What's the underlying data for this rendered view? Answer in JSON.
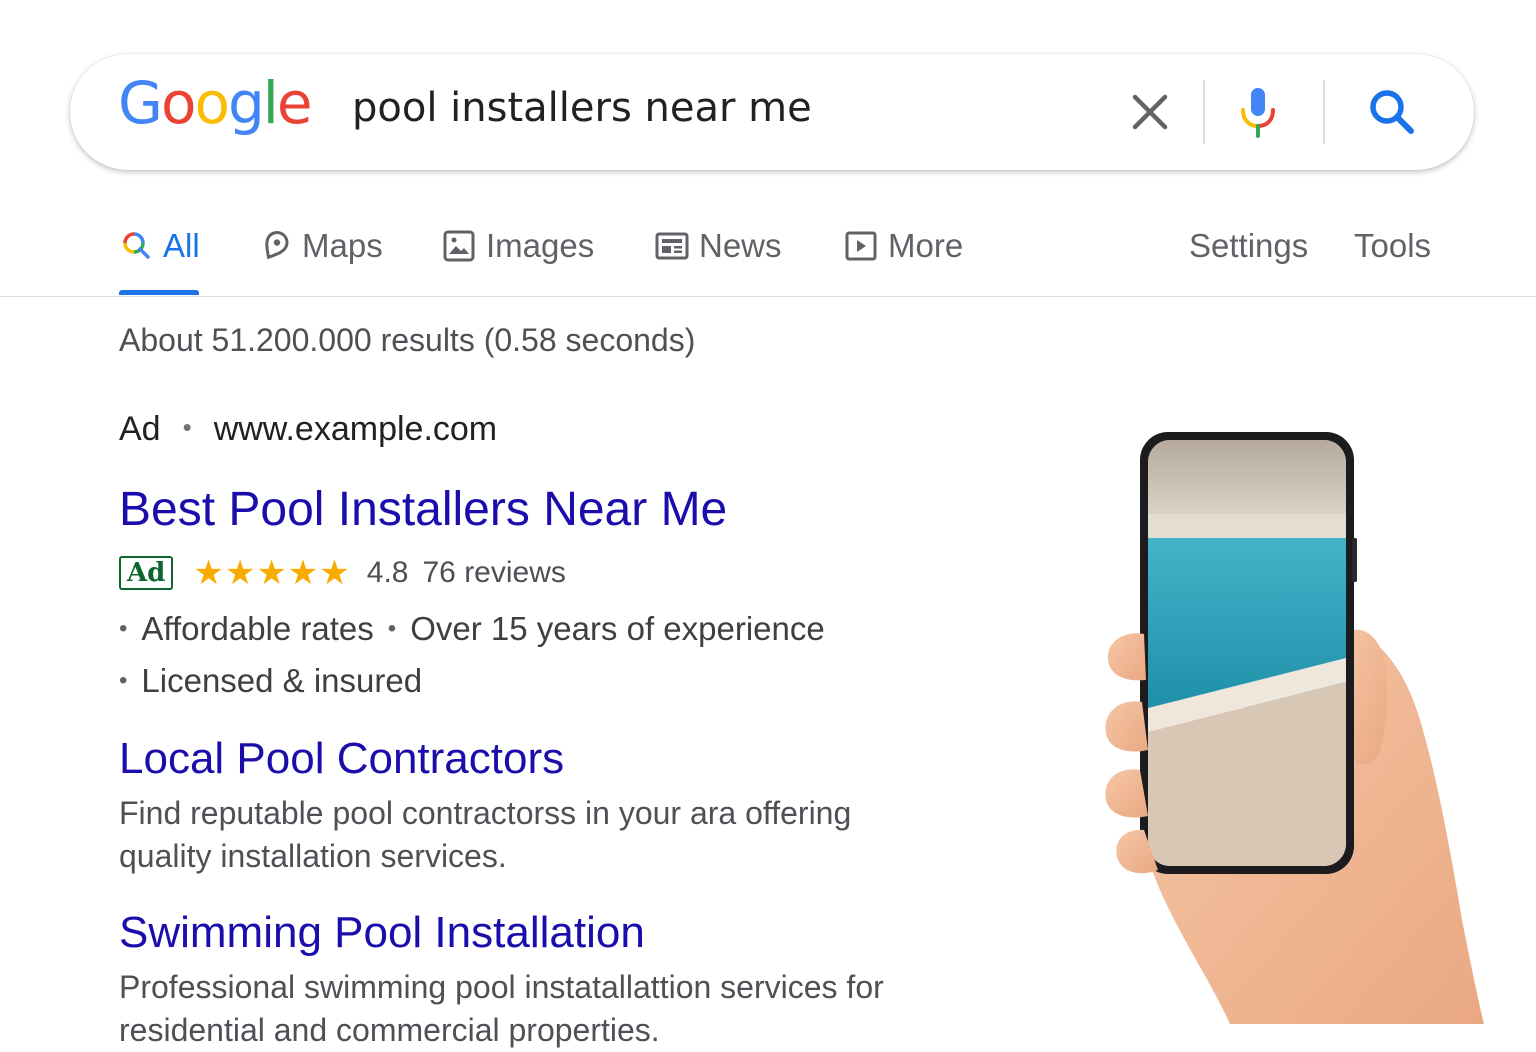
{
  "search": {
    "logo_letters": [
      {
        "ch": "G",
        "color": "#4285F4"
      },
      {
        "ch": "o",
        "color": "#EA4335"
      },
      {
        "ch": "o",
        "color": "#FBBC05"
      },
      {
        "ch": "g",
        "color": "#4285F4"
      },
      {
        "ch": "l",
        "color": "#34A853"
      },
      {
        "ch": "e",
        "color": "#EA4335"
      }
    ],
    "query": "pool installers near me",
    "icons": [
      "close-icon",
      "microphone-icon",
      "search-icon"
    ]
  },
  "tabs": {
    "all": "All",
    "maps": "Maps",
    "images": "Images",
    "news": "News",
    "more": "More",
    "settings": "Settings",
    "tools": "Tools",
    "active": "all"
  },
  "results": {
    "stats": "About 51.200.000 results (0.58 seconds)",
    "ad_label": "Ad",
    "ad_url": "www.example.com",
    "main_title": "Best Pool Installers Near Me",
    "ad_badge": "Ad",
    "stars": "★★★★★",
    "rating": "4.8",
    "reviews": "76 reviews",
    "bullets": [
      "Affordable rates",
      "Over 15 years of experience",
      "Licensed & insured"
    ],
    "sitelinks": [
      {
        "title": "Local Pool Contractors",
        "snippet": "Find reputable pool contractorss in your ara offering quality installation services."
      },
      {
        "title": "Swimming Pool Installation",
        "snippet": "Professional swimming pool instatallattion services for residential and commercial properties."
      }
    ]
  },
  "colors": {
    "link": "#1a0dab",
    "accent": "#1a73e8",
    "star": "#f9ab00",
    "ad_badge": "#0d652d"
  }
}
